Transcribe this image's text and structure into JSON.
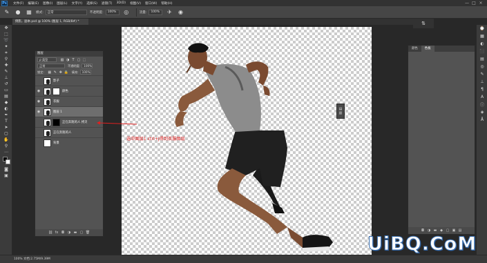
{
  "app": {
    "logo": "Ps",
    "menu": [
      "文件(F)",
      "编辑(E)",
      "图像(I)",
      "图层(L)",
      "文字(Y)",
      "选择(S)",
      "滤镜(T)",
      "3D(D)",
      "视图(V)",
      "窗口(W)",
      "帮助(H)"
    ],
    "window_controls": [
      "—",
      "□",
      "×"
    ]
  },
  "options": {
    "mode_label": "模式:",
    "mode_value": "正常",
    "opacity_label": "不透明度:",
    "opacity_value": "100%",
    "flow_label": "流量:",
    "flow_value": "100%"
  },
  "document": {
    "tab_title": "倒影，副本.psd @ 100% (图层 1, RGB/8#) *"
  },
  "layers_panel": {
    "title": "图层",
    "filter_kind": "ρ 类型",
    "blend_mode": "正常",
    "opacity_label": "不透明度:",
    "opacity_value": "100%",
    "lock_label": "锁定:",
    "fill_label": "填充:",
    "fill_value": "100%",
    "layers": [
      {
        "name": "影子",
        "visible": false,
        "selected": false,
        "has_mask": false
      },
      {
        "name": "颜色",
        "visible": true,
        "selected": false,
        "has_mask": true
      },
      {
        "name": "衣服",
        "visible": true,
        "selected": false,
        "has_mask": false
      },
      {
        "name": "图层 1",
        "visible": true,
        "selected": true,
        "has_mask": false
      },
      {
        "name": "正在奔跑的人 拷贝",
        "visible": false,
        "selected": false,
        "has_mask": true
      },
      {
        "name": "正在奔跑的人",
        "visible": false,
        "selected": false,
        "has_mask": false
      },
      {
        "name": "背景",
        "visible": false,
        "selected": false,
        "has_mask": false
      }
    ]
  },
  "annotation": {
    "text": "选中图层1 ctrl+j得到衣服图层"
  },
  "right_panel": {
    "tabs": [
      "颜色",
      "色板"
    ]
  },
  "status": {
    "text": "100%    文档:2.75M/9.39M"
  },
  "watermark": "UiBQ.CoM",
  "colors": {
    "annotation": "#e02020",
    "accent_blue": "#3a6fb0"
  }
}
